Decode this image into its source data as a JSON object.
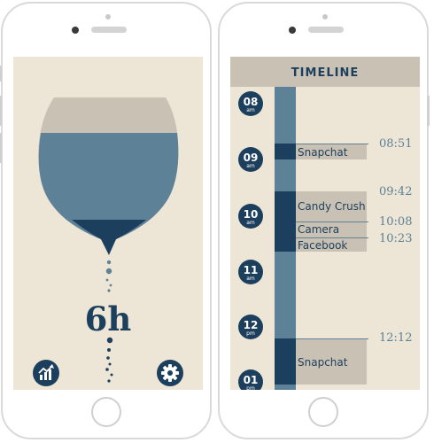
{
  "left_screen": {
    "remaining_time": "6h",
    "stats_button": "chart-trend-icon",
    "settings_button": "gear-icon"
  },
  "right_screen": {
    "title": "TIMELINE",
    "hours": [
      {
        "num": "08",
        "period": "am"
      },
      {
        "num": "09",
        "period": "am"
      },
      {
        "num": "10",
        "period": "am"
      },
      {
        "num": "11",
        "period": "am"
      },
      {
        "num": "12",
        "period": "pm"
      },
      {
        "num": "01",
        "period": "pm"
      }
    ],
    "entries": [
      {
        "app": "Snapchat",
        "time": "08:51"
      },
      {
        "app": "Candy Crush",
        "time": "09:42"
      },
      {
        "app": "Camera",
        "time": "10:08"
      },
      {
        "app": "Facebook",
        "time": "10:23"
      },
      {
        "app": "Snapchat",
        "time": "12:12"
      }
    ]
  },
  "colors": {
    "navy": "#1d3f5e",
    "steel_blue": "#5d8197",
    "sand": "#c9c1b3",
    "cream": "#ede5d5"
  }
}
